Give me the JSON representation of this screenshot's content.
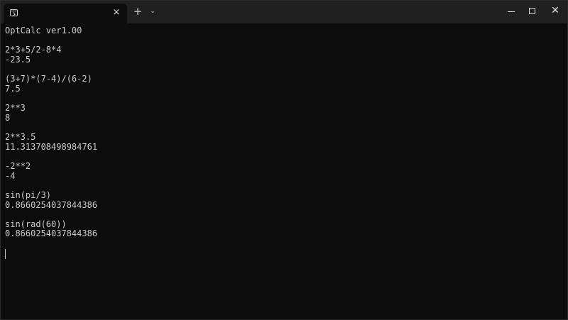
{
  "tab": {
    "title": "",
    "icon": "terminal-icon",
    "close_glyph": "×"
  },
  "titlebar": {
    "new_tab_glyph": "+",
    "dropdown_glyph": "⌄",
    "close_glyph": "✕"
  },
  "terminal": {
    "lines": [
      "OptCalc ver1.00",
      "",
      "2*3+5/2-8*4",
      "-23.5",
      "",
      "(3+7)*(7-4)/(6-2)",
      "7.5",
      "",
      "2**3",
      "8",
      "",
      "2**3.5",
      "11.313708498984761",
      "",
      "-2**2",
      "-4",
      "",
      "sin(pi/3)",
      "0.8660254037844386",
      "",
      "sin(rad(60))",
      "0.8660254037844386",
      ""
    ]
  },
  "colors": {
    "background": "#0c0c0c",
    "titlebar": "#202020",
    "text": "#cccccc"
  }
}
